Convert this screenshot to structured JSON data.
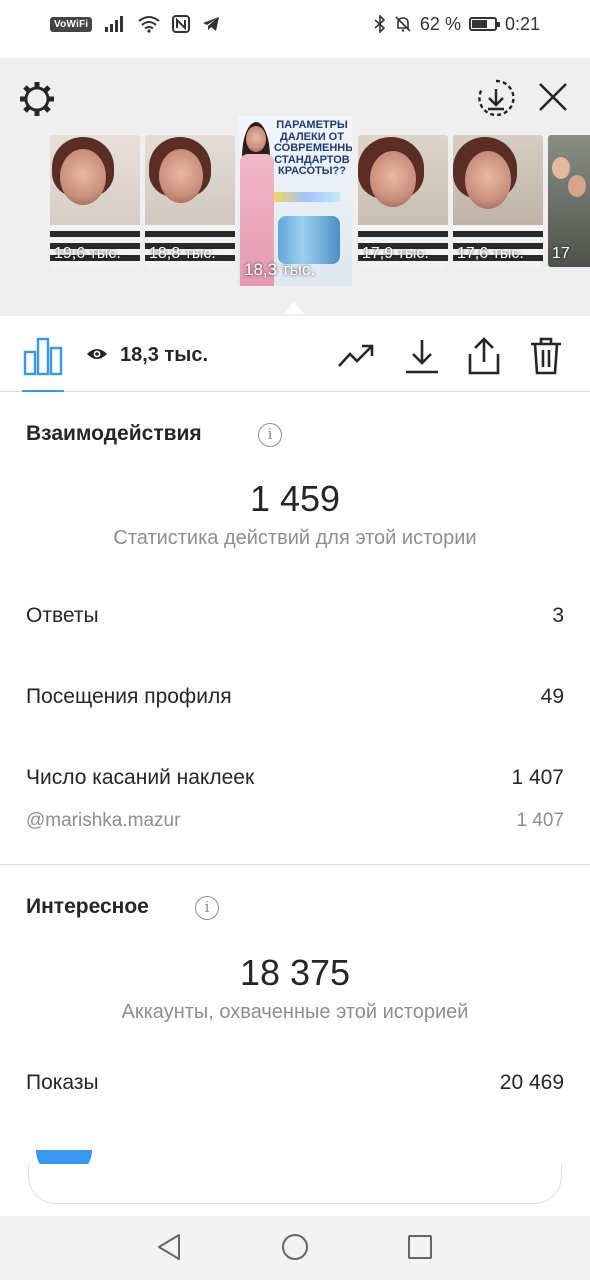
{
  "status_bar": {
    "vowifi": "VoWiFi",
    "battery_percent": "62 %",
    "battery_level": 0.62,
    "time": "0:21"
  },
  "stories": [
    {
      "views": "19,6 тыс."
    },
    {
      "views": "18,8 тыс."
    },
    {
      "views": "18,3 тыс.",
      "caption": "ПАРАМЕТРЫ ДАЛЕКИ ОТ СОВРЕМЕННЫХ СТАНДАРТОВ КРАСОТЫ??",
      "selected": true
    },
    {
      "views": "17,9 тыс."
    },
    {
      "views": "17,6 тыс."
    },
    {
      "views": "17"
    }
  ],
  "toolbar": {
    "reach": "18,3 тыс."
  },
  "interactions": {
    "title": "Взаимодействия",
    "info": "i",
    "total": "1 459",
    "caption": "Статистика действий для этой истории",
    "rows": [
      {
        "label": "Ответы",
        "value": "3"
      },
      {
        "label": "Посещения профиля",
        "value": "49"
      },
      {
        "label": "Число касаний наклеек",
        "value": "1 407"
      }
    ],
    "sticker": {
      "label": "@marishka.mazur",
      "value": "1 407"
    }
  },
  "discovery": {
    "title": "Интересное",
    "info": "i",
    "total": "18 375",
    "caption": "Аккаунты, охваченные этой историей",
    "rows": [
      {
        "label": "Показы",
        "value": "20 469"
      }
    ]
  },
  "colors": {
    "accent": "#3897f0",
    "text": "#262626",
    "secondary": "#8e8e8e",
    "header_bg": "#efefef"
  }
}
